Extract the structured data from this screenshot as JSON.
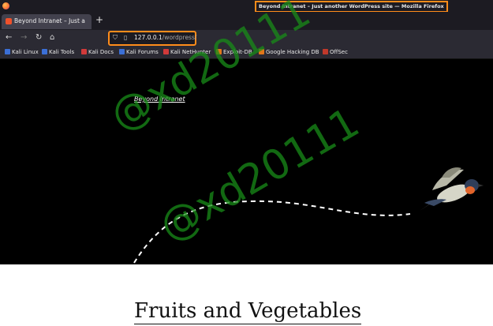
{
  "window": {
    "title": "Beyond Intranet – Just another WordPress site — Mozilla Firefox"
  },
  "tabs": [
    {
      "label": "Beyond Intranet – Just another WordPress site"
    }
  ],
  "address_bar": {
    "host": "127.0.0.1",
    "path": "/wordpress/"
  },
  "bookmarks": [
    {
      "label": "Kali Linux",
      "icon": "kali-icon"
    },
    {
      "label": "Kali Tools",
      "icon": "kali-icon"
    },
    {
      "label": "Kali Docs",
      "icon": "kali-docs-icon"
    },
    {
      "label": "Kali Forums",
      "icon": "kali-icon"
    },
    {
      "label": "Kali NetHunter",
      "icon": "nethunter-icon"
    },
    {
      "label": "Exploit-DB",
      "icon": "exploit-db-icon"
    },
    {
      "label": "Google Hacking DB",
      "icon": "ghdb-icon"
    },
    {
      "label": "OffSec",
      "icon": "offsec-icon"
    }
  ],
  "site": {
    "name": "Beyond Intranet"
  },
  "post": {
    "title": "Fruits and Vegetables"
  },
  "watermark": {
    "text": "@xd20111"
  },
  "colors": {
    "highlight": "#ff8c1a",
    "watermark": "#188c18"
  }
}
